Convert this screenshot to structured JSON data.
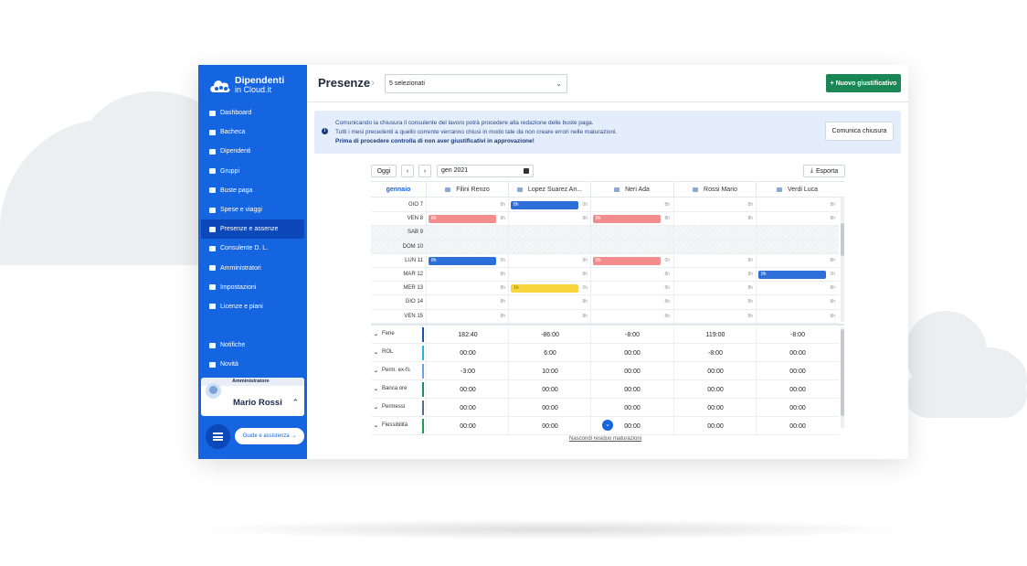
{
  "app": {
    "logo_line1": "Dipendenti",
    "logo_line2": "in Cloud.it"
  },
  "sidebar": {
    "items": [
      {
        "label": "Dashboard",
        "icon": "dashboard-icon"
      },
      {
        "label": "Bacheca",
        "icon": "megaphone-icon"
      },
      {
        "label": "Dipendenti",
        "icon": "users-icon"
      },
      {
        "label": "Gruppi",
        "icon": "group-icon"
      },
      {
        "label": "Buste paga",
        "icon": "payslip-icon"
      },
      {
        "label": "Spese e viaggi",
        "icon": "car-icon"
      },
      {
        "label": "Presenze e assenze",
        "icon": "calendar-icon",
        "active": true
      },
      {
        "label": "Consulente D. L.",
        "icon": "consultant-icon"
      },
      {
        "label": "Amministratori",
        "icon": "admin-icon"
      },
      {
        "label": "Impostazioni",
        "icon": "gear-icon"
      },
      {
        "label": "Licenze e piani",
        "icon": "moon-icon"
      }
    ],
    "bottom_items": [
      {
        "label": "Notifiche",
        "icon": "bell-icon"
      },
      {
        "label": "Novità",
        "icon": "flame-icon"
      }
    ],
    "user": {
      "role": "Amministratore",
      "name": "Mario Rossi"
    },
    "help_label": "Guide e assistenza →"
  },
  "header": {
    "title": "Presenze",
    "select_value": "5 selezionati",
    "new_button": "+ Nuovo giustificativo"
  },
  "alert": {
    "line1": "Comunicando la chiusura il consulente del lavoro potrà procedere alla redazione delle buste paga.",
    "line2": "Tutti i mesi precedenti a quello corrente verranno chiusi in modo tale da non creare errori nelle maturazioni.",
    "line3": "Prima di procedere controlla di non aver giustificativi in approvazione!",
    "button": "Comunica chiusura"
  },
  "toolbar": {
    "today": "Oggi",
    "prev": "‹",
    "next": "›",
    "date": "gen 2021",
    "export": "Esporta"
  },
  "grid": {
    "month": "gennaio",
    "employees": [
      "Filini Renzo",
      "Lopez Suarez An...",
      "Neri Ada",
      "Rossi Mario",
      "Verdi Luca"
    ],
    "rows": [
      {
        "day": "GIO 7",
        "cells": [
          "8h",
          "0h",
          "8h",
          "8h",
          "8h"
        ],
        "pills": [
          null,
          {
            "color": "blue",
            "text": "8h"
          },
          null,
          null,
          null
        ]
      },
      {
        "day": "VEN 8",
        "cells": [
          "8h",
          "8h",
          "8h",
          "8h",
          "8h"
        ],
        "pills": [
          {
            "color": "red",
            "text": "8h"
          },
          null,
          {
            "color": "red",
            "text": "8h"
          },
          null,
          null
        ]
      },
      {
        "day": "SAB 9",
        "weekend": true,
        "cells": [
          "",
          "",
          "",
          "",
          ""
        ],
        "pills": [
          null,
          null,
          null,
          null,
          null
        ]
      },
      {
        "day": "DOM 10",
        "weekend": true,
        "cells": [
          "",
          "",
          "",
          "",
          ""
        ],
        "pills": [
          null,
          null,
          null,
          null,
          null
        ]
      },
      {
        "day": "LUN 11",
        "cells": [
          "0h",
          "8h",
          "0h",
          "8h",
          "8h"
        ],
        "pills": [
          {
            "color": "blue",
            "text": "8h"
          },
          null,
          {
            "color": "red",
            "text": "8h"
          },
          null,
          null
        ]
      },
      {
        "day": "MAR 12",
        "cells": [
          "8h",
          "8h",
          "8h",
          "8h",
          "0h"
        ],
        "pills": [
          null,
          null,
          null,
          null,
          {
            "color": "blue",
            "text": "8h"
          }
        ]
      },
      {
        "day": "MER 13",
        "cells": [
          "8h",
          "0h",
          "8h",
          "8h",
          "8h"
        ],
        "pills": [
          null,
          {
            "color": "yellow",
            "text": "1h"
          },
          null,
          null,
          null
        ]
      },
      {
        "day": "GIO 14",
        "cells": [
          "8h",
          "8h",
          "8h",
          "8h",
          "8h"
        ],
        "pills": [
          null,
          null,
          null,
          null,
          null
        ]
      },
      {
        "day": "VEN 15",
        "cells": [
          "8h",
          "8h",
          "8h",
          "8h",
          "8h"
        ],
        "pills": [
          null,
          null,
          null,
          null,
          null
        ]
      }
    ]
  },
  "summary": {
    "rows": [
      {
        "label": "Ferie",
        "color": "#1a4fb5",
        "values": [
          "182:40",
          "-86:00",
          "-8:00",
          "119:00",
          "-8:00"
        ]
      },
      {
        "label": "ROL",
        "color": "#2bb3e0",
        "values": [
          "00:00",
          "6:00",
          "00:00",
          "-8:00",
          "00:00"
        ]
      },
      {
        "label": "Perm. ex-fs",
        "color": "#6aa1e8",
        "values": [
          "-3:00",
          "10:00",
          "00:00",
          "00:00",
          "00:00"
        ]
      },
      {
        "label": "Banca ore",
        "color": "#1e8a6e",
        "values": [
          "00:00",
          "00:00",
          "00:00",
          "00:00",
          "00:00"
        ]
      },
      {
        "label": "Permessi",
        "color": "#5a6b86",
        "values": [
          "00:00",
          "00:00",
          "00:00",
          "00:00",
          "00:00"
        ]
      },
      {
        "label": "Flessibilità",
        "color": "#1e9a5a",
        "values": [
          "00:00",
          "00:00",
          "00:00",
          "00:00",
          "00:00"
        ]
      }
    ],
    "hide_link": "Nascondi residuo maturazioni"
  }
}
